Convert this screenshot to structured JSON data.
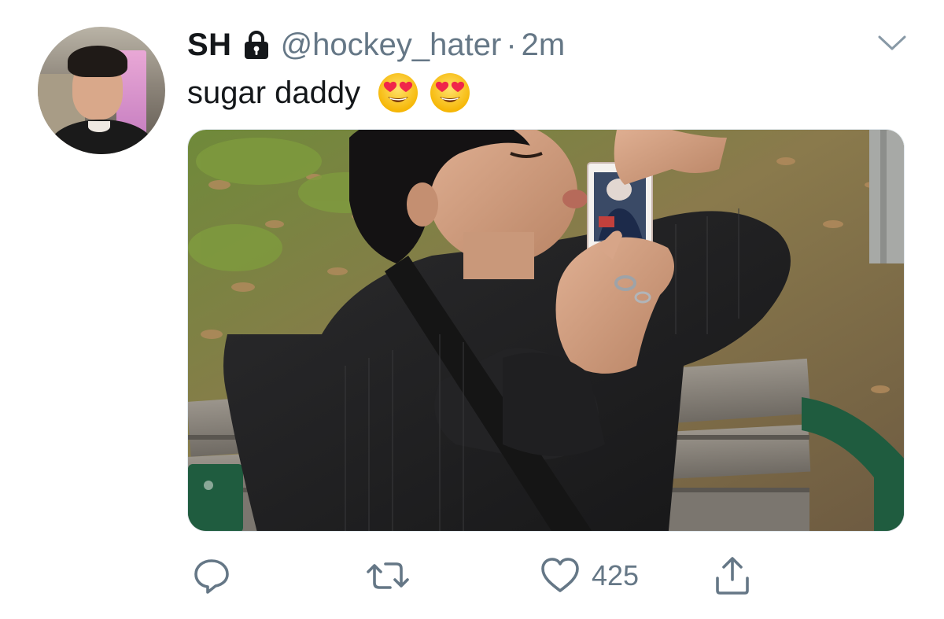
{
  "tweet": {
    "display_name": "SH",
    "handle": "@hockey_hater",
    "separator": "·",
    "timestamp": "2m",
    "text": "sugar daddy",
    "emojis": [
      "heart-eyes-emoji",
      "heart-eyes-emoji"
    ],
    "protected": true
  },
  "actions": {
    "reply_icon": "reply-icon",
    "retweet_icon": "retweet-icon",
    "like_icon": "heart-icon",
    "like_count": "425",
    "share_icon": "share-icon"
  },
  "colors": {
    "text_primary": "#14171a",
    "text_secondary": "#657786",
    "border": "#e1e8ed"
  }
}
